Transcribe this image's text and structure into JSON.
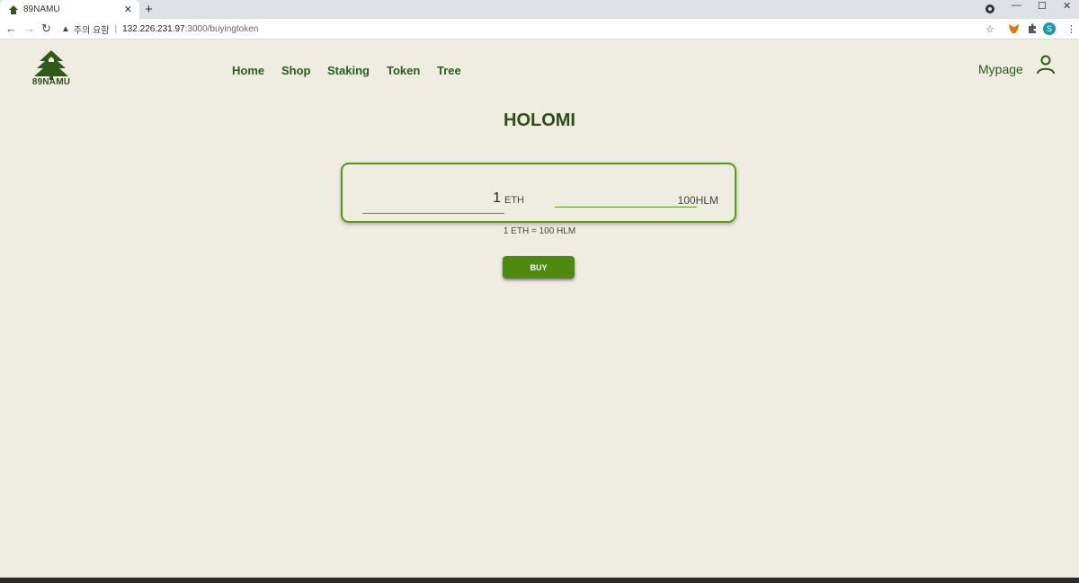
{
  "browser": {
    "tab_title": "89NAMU",
    "tab_close": "✕",
    "new_tab": "+",
    "security_label": "주의 요함",
    "url_host": "132.226.231.97",
    "url_path": ":3000/buyingtoken",
    "profile_initial": "S"
  },
  "header": {
    "logo_text": "89NAMU",
    "nav": [
      "Home",
      "Shop",
      "Staking",
      "Token",
      "Tree"
    ],
    "mypage": "Mypage"
  },
  "main": {
    "title": "HOLOMI",
    "eth_amount": "1",
    "eth_unit": "ETH",
    "hlm_amount": "100HLM",
    "rate": "1 ETH = 100 HLM",
    "buy_label": "BUY"
  },
  "colors": {
    "background": "#efece1",
    "brand_green": "#5b9616",
    "button_green": "#4e8a0f",
    "text_green": "#2e5a1c"
  }
}
